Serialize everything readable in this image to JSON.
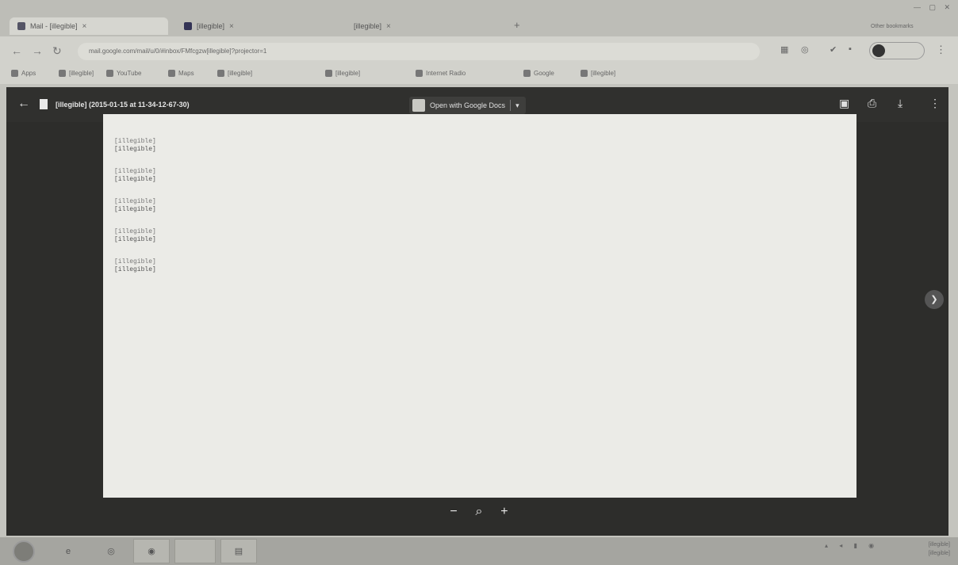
{
  "browser": {
    "tabs": [
      {
        "label": "Mail - [illegible]",
        "active": true,
        "favicon_color": "#556"
      },
      {
        "label": "[illegible]",
        "active": false,
        "favicon_color": "#335"
      },
      {
        "label": "[illegible]",
        "active": false,
        "favicon_color": "#aaa"
      }
    ],
    "new_tab": "+",
    "url": "mail.google.com/mail/u/0/#inbox/FMfcgzw[illegible]?projector=1",
    "profile_initial": "",
    "profile_label": "",
    "other_bookmarks": "Other bookmarks",
    "bookmarks": [
      "Apps",
      "[illegible]",
      "YouTube",
      "Maps",
      "[illegible]",
      "[illegible]",
      "Internet Radio",
      "Google",
      "[illegible]"
    ]
  },
  "viewer": {
    "file_title": "[illegible] (2015-01-15 at 11-34-12-67-30)",
    "open_with_label": "Open with Google Docs",
    "zoom_out": "−",
    "zoom_icon": "magnifier-icon",
    "zoom_in": "+",
    "next": "next-arrow-icon",
    "entries": [
      {
        "timestamp": "[illegible]",
        "text": "[illegible]"
      },
      {
        "timestamp": "[illegible]",
        "text": "[illegible]"
      },
      {
        "timestamp": "[illegible]",
        "text": "[illegible]"
      },
      {
        "timestamp": "[illegible]",
        "text": "[illegible]"
      },
      {
        "timestamp": "[illegible]",
        "text": "[illegible]"
      }
    ]
  },
  "taskbar": {
    "items": [
      "start-orb",
      "ie-icon",
      "chrome-icon",
      "blank-window",
      "explorer-icon"
    ],
    "tray_icons": "▴ ◂ ▮ ◉",
    "clock_time": "[illegible]",
    "clock_date": "[illegible]"
  },
  "colors": {
    "viewer_bg": "#2d2d2b",
    "page_bg": "#ebebe7"
  }
}
